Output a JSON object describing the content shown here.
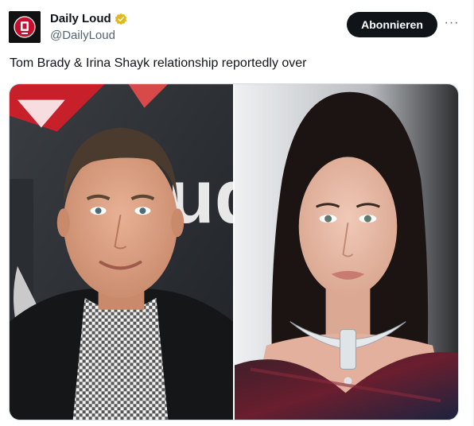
{
  "author": {
    "display_name": "Daily Loud",
    "handle": "@DailyLoud",
    "verified_color": "#e2b719"
  },
  "follow_label": "Abonnieren",
  "more_label": "···",
  "tweet": {
    "text": "Tom Brady & Irina Shayk relationship reportedly over"
  },
  "media": {
    "photos": [
      {
        "subject": "man-portrait",
        "backdrop_text": "ud"
      },
      {
        "subject": "woman-portrait"
      }
    ]
  },
  "colors": {
    "button_bg": "#0f1419",
    "secondary_text": "#536471"
  }
}
